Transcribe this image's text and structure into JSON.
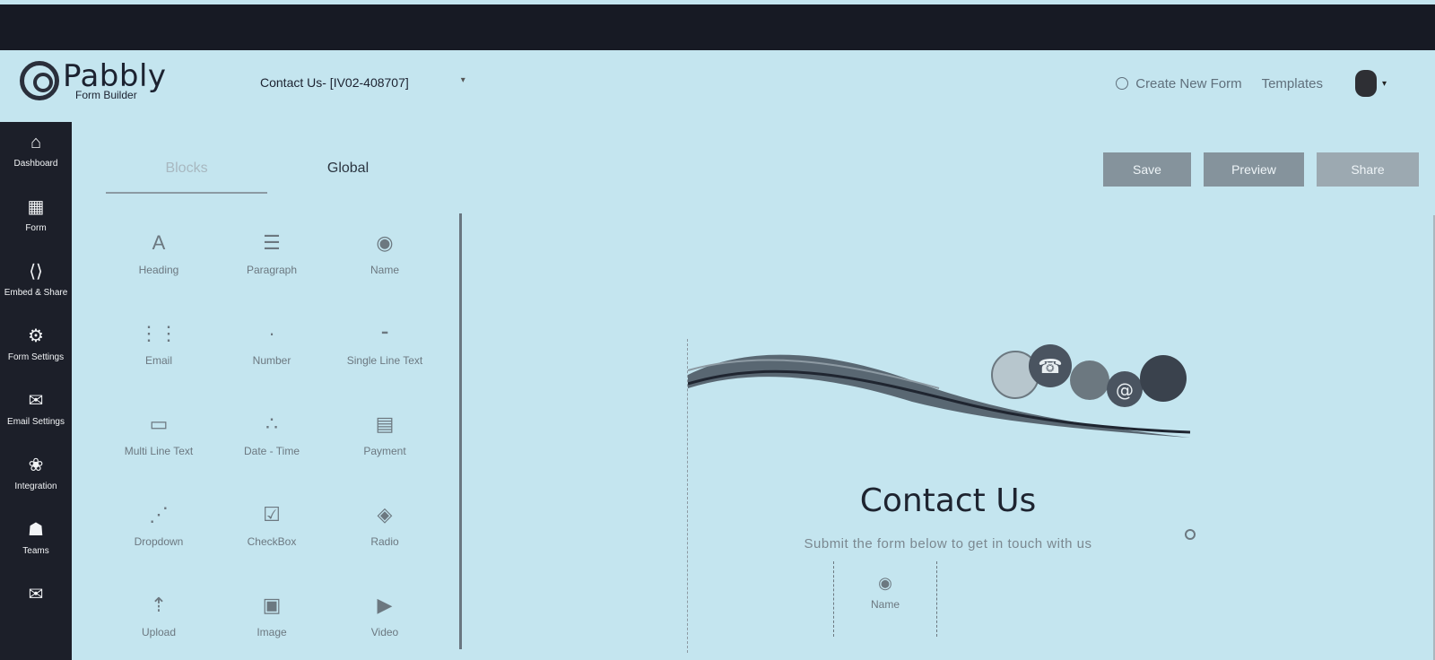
{
  "header": {
    "brand": "Pabbly",
    "brand_sub": "Form Builder",
    "form_selector": "Contact Us- [IV02-408707]",
    "create_new_form": "Create New Form",
    "templates": "Templates"
  },
  "sidebar": {
    "items": [
      {
        "label": "Dashboard",
        "icon": "home-icon"
      },
      {
        "label": "Form",
        "icon": "form-icon"
      },
      {
        "label": "Embed & Share",
        "icon": "code-icon"
      },
      {
        "label": "Form Settings",
        "icon": "gear-icon"
      },
      {
        "label": "Email Settings",
        "icon": "mail-open-icon"
      },
      {
        "label": "Integration",
        "icon": "integration-icon"
      },
      {
        "label": "Teams",
        "icon": "team-icon"
      },
      {
        "label": "",
        "icon": "envelope-icon"
      }
    ]
  },
  "panel": {
    "tabs": {
      "blocks": "Blocks",
      "global": "Global"
    },
    "blocks": [
      {
        "label": "Heading",
        "icon": "heading-icon"
      },
      {
        "label": "Paragraph",
        "icon": "paragraph-icon"
      },
      {
        "label": "Name",
        "icon": "user-circle-icon"
      },
      {
        "label": "Email",
        "icon": "email-icon"
      },
      {
        "label": "Number",
        "icon": "number-icon"
      },
      {
        "label": "Single Line Text",
        "icon": "text-line-icon"
      },
      {
        "label": "Multi Line Text",
        "icon": "text-area-icon"
      },
      {
        "label": "Date - Time",
        "icon": "calendar-icon"
      },
      {
        "label": "Payment",
        "icon": "payment-icon"
      },
      {
        "label": "Dropdown",
        "icon": "dropdown-icon"
      },
      {
        "label": "CheckBox",
        "icon": "checkbox-icon"
      },
      {
        "label": "Radio",
        "icon": "radio-icon"
      },
      {
        "label": "Upload",
        "icon": "upload-icon"
      },
      {
        "label": "Image",
        "icon": "image-icon"
      },
      {
        "label": "Video",
        "icon": "video-icon"
      }
    ]
  },
  "actions": {
    "save": "Save",
    "preview": "Preview",
    "share": "Share"
  },
  "form": {
    "title": "Contact Us",
    "subtitle": "Submit the form below to get in touch with us",
    "name_field_label": "Name"
  }
}
